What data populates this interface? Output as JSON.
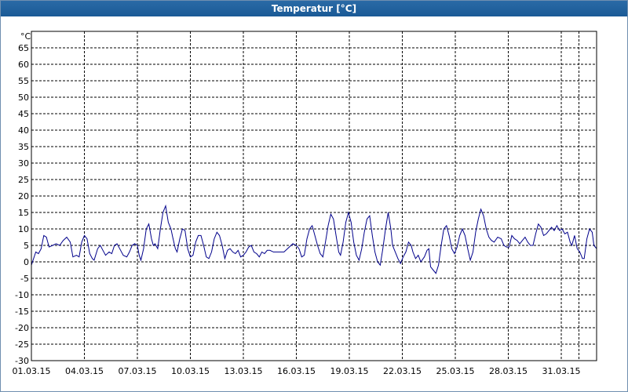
{
  "window": {
    "title": "Temperatur [°C]"
  },
  "colors": {
    "title_bar": "#1a5a96",
    "line": "#00008b",
    "grid": "#000000"
  },
  "chart_data": {
    "type": "line",
    "title": "Temperatur [°C]",
    "unit_label": "°C",
    "grid": true,
    "ylim": [
      -30,
      70
    ],
    "y_ticks": [
      65,
      60,
      55,
      50,
      45,
      40,
      35,
      30,
      25,
      20,
      15,
      10,
      5,
      0,
      -5,
      -10,
      -15,
      -20,
      -25,
      -30
    ],
    "x_tick_labels": [
      "01.03.15",
      "04.03.15",
      "07.03.15",
      "10.03.15",
      "13.03.15",
      "16.03.15",
      "19.03.15",
      "22.03.15",
      "25.03.15",
      "28.03.15",
      "31.03.15"
    ],
    "x_day_range": [
      1,
      32
    ],
    "series": [
      {
        "points": [
          [
            1.0,
            -1
          ],
          [
            1.25,
            3
          ],
          [
            1.4,
            2.5
          ],
          [
            1.55,
            4
          ],
          [
            1.7,
            8
          ],
          [
            1.85,
            7.5
          ],
          [
            2.0,
            4.5
          ],
          [
            2.2,
            5
          ],
          [
            2.4,
            5.5
          ],
          [
            2.6,
            5
          ],
          [
            2.8,
            6.5
          ],
          [
            3.0,
            7.5
          ],
          [
            3.2,
            6
          ],
          [
            3.35,
            1.5
          ],
          [
            3.55,
            2
          ],
          [
            3.7,
            1.5
          ],
          [
            3.85,
            6
          ],
          [
            4.0,
            8
          ],
          [
            4.15,
            7
          ],
          [
            4.3,
            2.5
          ],
          [
            4.45,
            1
          ],
          [
            4.55,
            0.5
          ],
          [
            4.75,
            4
          ],
          [
            4.9,
            5
          ],
          [
            5.05,
            3.5
          ],
          [
            5.2,
            2
          ],
          [
            5.4,
            3
          ],
          [
            5.55,
            2.5
          ],
          [
            5.7,
            5
          ],
          [
            5.85,
            5.5
          ],
          [
            6.0,
            4
          ],
          [
            6.2,
            2
          ],
          [
            6.4,
            1.5
          ],
          [
            6.55,
            3
          ],
          [
            6.7,
            5
          ],
          [
            6.85,
            5.5
          ],
          [
            7.0,
            5
          ],
          [
            7.1,
            2
          ],
          [
            7.2,
            0.5
          ],
          [
            7.35,
            4
          ],
          [
            7.5,
            10
          ],
          [
            7.65,
            11.5
          ],
          [
            7.8,
            7
          ],
          [
            7.9,
            5
          ],
          [
            8.0,
            5.5
          ],
          [
            8.15,
            4
          ],
          [
            8.3,
            10
          ],
          [
            8.45,
            15
          ],
          [
            8.6,
            17
          ],
          [
            8.75,
            12
          ],
          [
            8.9,
            10
          ],
          [
            9.0,
            7.5
          ],
          [
            9.15,
            4
          ],
          [
            9.25,
            3
          ],
          [
            9.4,
            7
          ],
          [
            9.55,
            10
          ],
          [
            9.7,
            9.5
          ],
          [
            9.85,
            4
          ],
          [
            10.0,
            1.5
          ],
          [
            10.15,
            2
          ],
          [
            10.3,
            6
          ],
          [
            10.45,
            8
          ],
          [
            10.6,
            8
          ],
          [
            10.75,
            5
          ],
          [
            10.9,
            1.5
          ],
          [
            11.05,
            1
          ],
          [
            11.2,
            3
          ],
          [
            11.35,
            7
          ],
          [
            11.5,
            9
          ],
          [
            11.65,
            8
          ],
          [
            11.8,
            5
          ],
          [
            11.95,
            1
          ],
          [
            12.1,
            3.5
          ],
          [
            12.25,
            4
          ],
          [
            12.4,
            3
          ],
          [
            12.55,
            2.5
          ],
          [
            12.7,
            3.5
          ],
          [
            12.85,
            1.5
          ],
          [
            13.0,
            2
          ],
          [
            13.15,
            3
          ],
          [
            13.3,
            4.5
          ],
          [
            13.45,
            5
          ],
          [
            13.6,
            3
          ],
          [
            13.75,
            2.5
          ],
          [
            13.9,
            1.5
          ],
          [
            14.05,
            3
          ],
          [
            14.2,
            2.5
          ],
          [
            14.35,
            3.5
          ],
          [
            14.5,
            3.5
          ],
          [
            14.7,
            3
          ],
          [
            15.0,
            3
          ],
          [
            15.3,
            3
          ],
          [
            15.6,
            4.5
          ],
          [
            15.8,
            5.5
          ],
          [
            16.0,
            5
          ],
          [
            16.15,
            4
          ],
          [
            16.3,
            1.5
          ],
          [
            16.45,
            2
          ],
          [
            16.6,
            7
          ],
          [
            16.75,
            10
          ],
          [
            16.9,
            11
          ],
          [
            17.05,
            8
          ],
          [
            17.2,
            5
          ],
          [
            17.35,
            2.5
          ],
          [
            17.5,
            1.5
          ],
          [
            17.65,
            6
          ],
          [
            17.8,
            11
          ],
          [
            17.95,
            14.5
          ],
          [
            18.1,
            13
          ],
          [
            18.25,
            8
          ],
          [
            18.4,
            3
          ],
          [
            18.5,
            2
          ],
          [
            18.65,
            6
          ],
          [
            18.8,
            12
          ],
          [
            18.95,
            15
          ],
          [
            19.1,
            12
          ],
          [
            19.25,
            6
          ],
          [
            19.4,
            2
          ],
          [
            19.55,
            0.5
          ],
          [
            19.7,
            4
          ],
          [
            19.85,
            9
          ],
          [
            20.0,
            13
          ],
          [
            20.15,
            14
          ],
          [
            20.3,
            8
          ],
          [
            20.45,
            3
          ],
          [
            20.6,
            0
          ],
          [
            20.75,
            -1
          ],
          [
            20.9,
            4
          ],
          [
            21.05,
            10
          ],
          [
            21.2,
            15
          ],
          [
            21.35,
            10
          ],
          [
            21.45,
            5
          ],
          [
            21.6,
            3
          ],
          [
            21.75,
            1
          ],
          [
            21.9,
            -0.5
          ],
          [
            22.05,
            1.5
          ],
          [
            22.2,
            3
          ],
          [
            22.35,
            6
          ],
          [
            22.5,
            5
          ],
          [
            22.6,
            3
          ],
          [
            22.75,
            1
          ],
          [
            22.9,
            2
          ],
          [
            23.05,
            0
          ],
          [
            23.25,
            1.5
          ],
          [
            23.4,
            3.5
          ],
          [
            23.5,
            4
          ],
          [
            23.6,
            -1.5
          ],
          [
            23.75,
            -2.5
          ],
          [
            23.9,
            -3.5
          ],
          [
            24.05,
            -1
          ],
          [
            24.2,
            5
          ],
          [
            24.35,
            10
          ],
          [
            24.5,
            11
          ],
          [
            24.65,
            8
          ],
          [
            24.8,
            4
          ],
          [
            24.95,
            2.5
          ],
          [
            25.1,
            4.5
          ],
          [
            25.25,
            8
          ],
          [
            25.4,
            10
          ],
          [
            25.55,
            8
          ],
          [
            25.7,
            4
          ],
          [
            25.85,
            0.5
          ],
          [
            26.0,
            3
          ],
          [
            26.15,
            9
          ],
          [
            26.3,
            13
          ],
          [
            26.45,
            16
          ],
          [
            26.6,
            14
          ],
          [
            26.75,
            10
          ],
          [
            26.9,
            7.5
          ],
          [
            27.05,
            6.5
          ],
          [
            27.2,
            6
          ],
          [
            27.4,
            7.5
          ],
          [
            27.6,
            7
          ],
          [
            27.75,
            5
          ],
          [
            27.9,
            4.5
          ],
          [
            28.05,
            4.5
          ],
          [
            28.2,
            8
          ],
          [
            28.35,
            7
          ],
          [
            28.5,
            6.5
          ],
          [
            28.65,
            5.5
          ],
          [
            28.8,
            6.5
          ],
          [
            28.95,
            7.5
          ],
          [
            29.1,
            6
          ],
          [
            29.25,
            5
          ],
          [
            29.4,
            5
          ],
          [
            29.55,
            8.5
          ],
          [
            29.7,
            11.5
          ],
          [
            29.85,
            10.5
          ],
          [
            30.0,
            8
          ],
          [
            30.15,
            8.5
          ],
          [
            30.3,
            9.5
          ],
          [
            30.45,
            10.5
          ],
          [
            30.6,
            9.5
          ],
          [
            30.75,
            11
          ],
          [
            30.9,
            9.5
          ],
          [
            31.05,
            10
          ],
          [
            31.2,
            8.5
          ],
          [
            31.35,
            9
          ],
          [
            31.5,
            6
          ],
          [
            31.6,
            5
          ],
          [
            31.75,
            8
          ],
          [
            31.9,
            4
          ],
          [
            32.05,
            3
          ],
          [
            32.2,
            1
          ],
          [
            32.3,
            1
          ],
          [
            32.45,
            7
          ],
          [
            32.6,
            10
          ],
          [
            32.75,
            9
          ],
          [
            32.85,
            5
          ],
          [
            33.0,
            4
          ]
        ]
      }
    ]
  }
}
